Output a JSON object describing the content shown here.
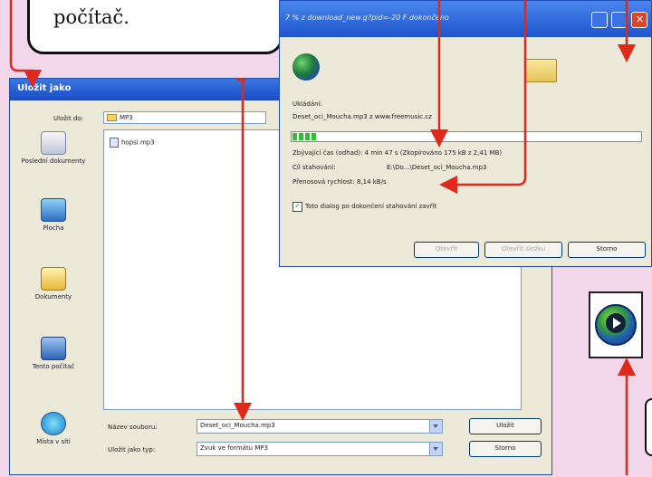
{
  "callout": {
    "text": "počítač."
  },
  "download_dialog": {
    "title": "7 % z download_new.g?pid=-20 F dokončeno",
    "saving_label": "Ukládání:",
    "file_line": "Deset_oci_Moucha.mp3 z www.freemusic.cz",
    "remaining": "Zbývající čas (odhad):  4 min 47 s (Zkopírováno 175 kB z 2,41 MB)",
    "target_label": "Cíl stahování:",
    "target_value": "E:\\Do...\\Deset_oci_Moucha.mp3",
    "rate": "Přenosová rychlost: 8,14 kB/s",
    "close_checkbox": "Toto dialog po dokončení stahování zavřít",
    "progress_fraction": 0.07,
    "buttons": {
      "open": "Otevřít",
      "open_folder": "Otevřít složku",
      "cancel": "Storno"
    }
  },
  "save_dialog": {
    "title": "Uložit jako",
    "save_in_label": "Uložit do:",
    "save_in_value": "MP3",
    "files": [
      "hopsi.mp3"
    ],
    "places": [
      "Poslední dokumenty",
      "Plocha",
      "Dokumenty",
      "Tento počítač",
      "Místa v síti"
    ],
    "filename_label": "Název souboru:",
    "filename_value": "Deset_oci_Moucha.mp3",
    "type_label": "Uložit jako typ:",
    "type_value": "Zvuk ve formátu MP3",
    "buttons": {
      "save": "Uložit",
      "cancel": "Storno"
    }
  },
  "colors": {
    "background": "#f2d6ea",
    "arrow": "#e0291b",
    "title_blue": "#1f55cc"
  }
}
